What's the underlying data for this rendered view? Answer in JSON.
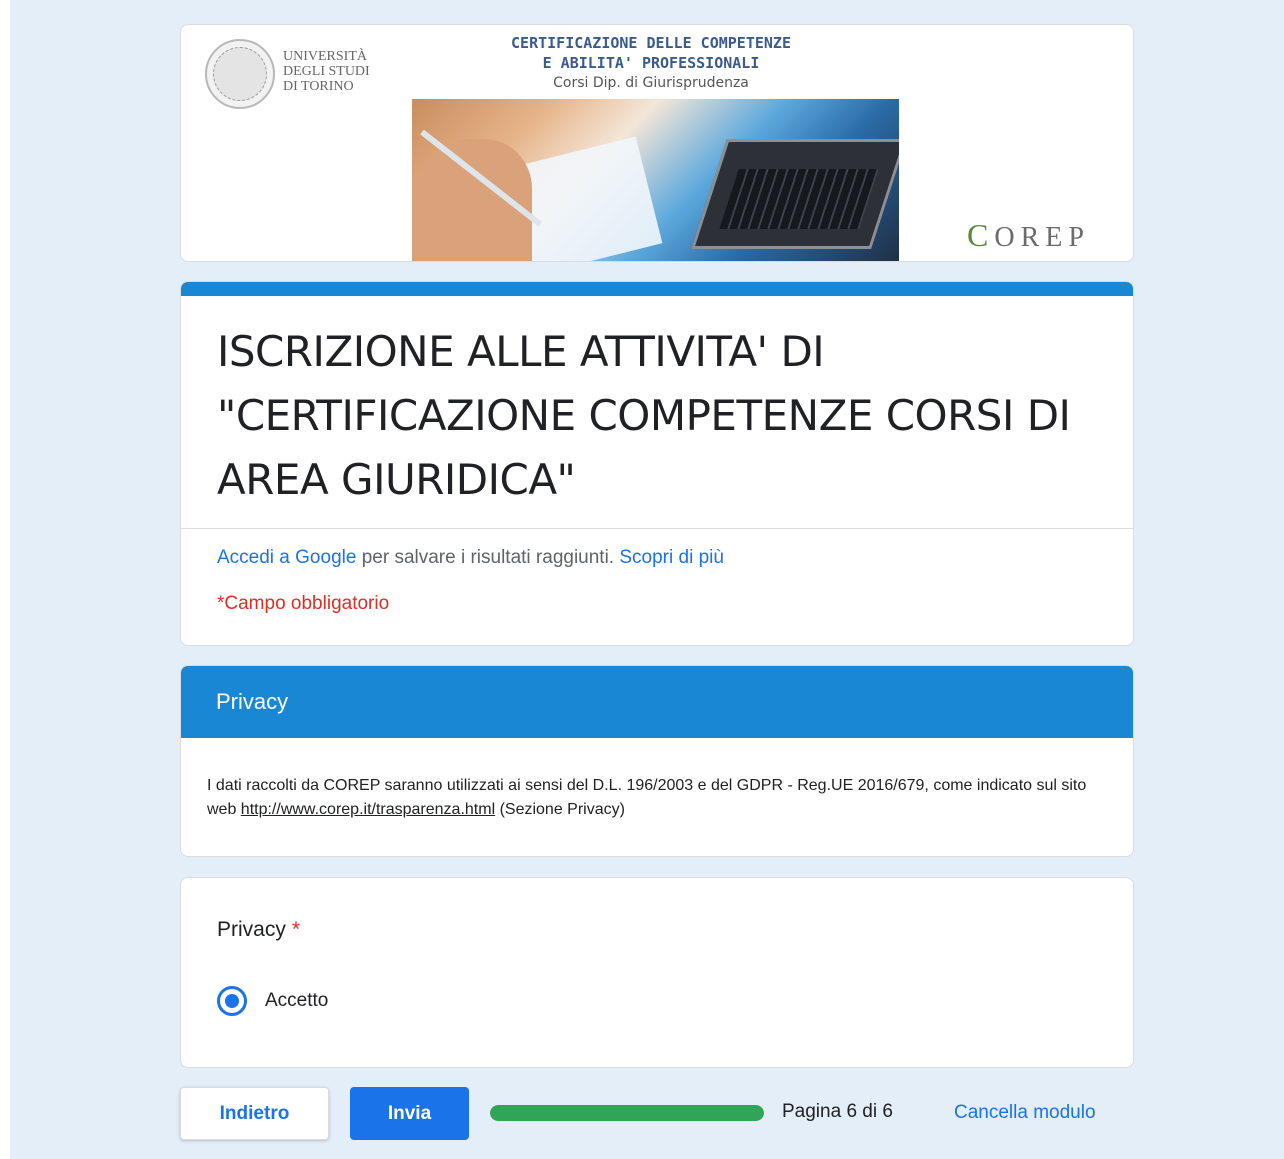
{
  "banner": {
    "university_lines": [
      "UNIVERSITÀ",
      "DEGLI STUDI",
      "DI TORINO"
    ],
    "title_line1": "CERTIFICAZIONE DELLE COMPETENZE",
    "title_line2": "E ABILITA' PROFESSIONALI",
    "subtitle": "Corsi Dip. di Giurisprudenza",
    "corep_logo": "OREP"
  },
  "form": {
    "title": "ISCRIZIONE ALLE ATTIVITA' DI \"CERTIFICAZIONE COMPETENZE CORSI DI AREA GIURIDICA\"",
    "signin_link": "Accedi a Google",
    "signin_text": " per salvare i risultati raggiunti. ",
    "learn_more": "Scopri di più",
    "required_note": "*Campo obbligatorio"
  },
  "section": {
    "title": "Privacy",
    "desc_before": "I dati raccolti da COREP saranno utilizzati ai sensi del D.L. 196/2003 e del GDPR - Reg.UE 2016/679, come indicato sul sito web ",
    "desc_link": "http://www.corep.it/trasparenza.html",
    "desc_after": " (Sezione Privacy)"
  },
  "question": {
    "title": "Privacy",
    "required_mark": "*",
    "options": [
      {
        "label": "Accetto",
        "selected": true
      }
    ]
  },
  "footer": {
    "back_label": "Indietro",
    "submit_label": "Invia",
    "progress_fraction": 1.0,
    "page_indicator": "Pagina 6 di 6",
    "clear_label": "Cancella modulo"
  },
  "colors": {
    "accent": "#1a87d4",
    "link": "#1a73e8",
    "required": "#d93025",
    "progress": "#31a457",
    "background": "#e3eef9"
  }
}
